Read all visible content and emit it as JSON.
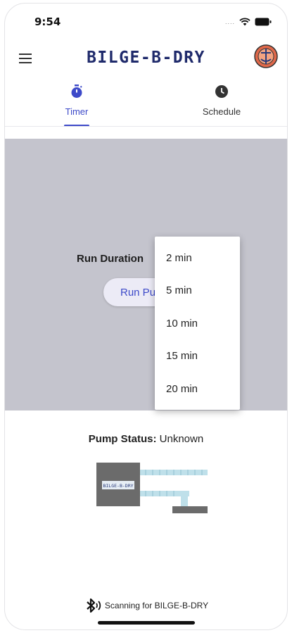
{
  "status_bar": {
    "time": "9:54",
    "signal": "....",
    "wifi_icon": "wifi-icon",
    "battery_icon": "battery-icon"
  },
  "app_bar": {
    "title": "BILGE-B-DRY",
    "menu_icon": "menu-icon",
    "avatar_icon": "avatar-icon"
  },
  "tabs": [
    {
      "label": "Timer",
      "icon": "stopwatch-icon",
      "selected": true
    },
    {
      "label": "Schedule",
      "icon": "clock-icon",
      "selected": false
    }
  ],
  "timer": {
    "run_duration_label": "Run Duration",
    "run_pump_button": "Run Pump",
    "dropdown_options": [
      "2 min",
      "5 min",
      "10 min",
      "15 min",
      "20 min"
    ]
  },
  "pump_status": {
    "label": "Pump Status:",
    "value": "Unknown",
    "device_label": "BILGE-B-DRY"
  },
  "footer": {
    "icon": "bluetooth-searching-icon",
    "text": "Scanning for BILGE-B-DRY"
  },
  "colors": {
    "accent": "#3d4ac9",
    "title": "#1f2a6b",
    "scrim": "#c4c4cd",
    "device": "#6b6b6b",
    "pipe": "#bfe0ea"
  }
}
